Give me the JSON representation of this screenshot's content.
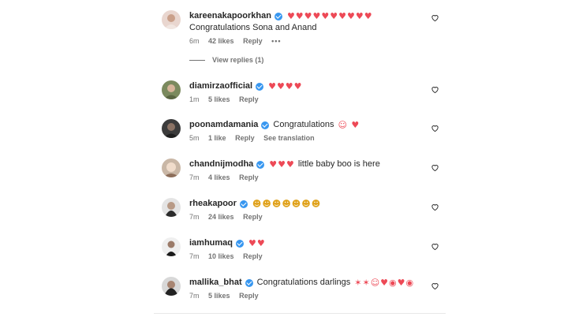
{
  "comments": [
    {
      "username": "kareenakapoorkhan",
      "text": "",
      "emoji": "♥♥♥♥♥♥♥♥♥♥",
      "emoji_kind": "heart",
      "second_line": "Congratulations Sona and Anand",
      "time": "6m",
      "likes": "42 likes",
      "reply": "Reply",
      "more": "•••",
      "extra": ""
    },
    {
      "username": "diamirzaofficial",
      "text": "",
      "emoji": "♥♥♥♥",
      "emoji_kind": "heart",
      "second_line": "",
      "time": "1m",
      "likes": "5 likes",
      "reply": "Reply",
      "more": "",
      "extra": ""
    },
    {
      "username": "poonamdamania",
      "text": "Congratulations",
      "emoji": "☺ ♥",
      "emoji_kind": "mixed",
      "second_line": "",
      "time": "5m",
      "likes": "1 like",
      "reply": "Reply",
      "more": "",
      "extra": "See translation"
    },
    {
      "username": "chandnijmodha",
      "text": "little baby boo is here",
      "emoji": "♥♥♥",
      "emoji_kind": "heart-before",
      "second_line": "",
      "time": "7m",
      "likes": "4 likes",
      "reply": "Reply",
      "more": "",
      "extra": ""
    },
    {
      "username": "rheakapoor",
      "text": "",
      "emoji": "☻☻☻☻☻☻☻",
      "emoji_kind": "face",
      "second_line": "",
      "time": "7m",
      "likes": "24 likes",
      "reply": "Reply",
      "more": "",
      "extra": ""
    },
    {
      "username": "iamhumaq",
      "text": "",
      "emoji": "♥♥",
      "emoji_kind": "heart",
      "second_line": "",
      "time": "7m",
      "likes": "10 likes",
      "reply": "Reply",
      "more": "",
      "extra": ""
    },
    {
      "username": "mallika_bhat",
      "text": "Congratulations darlings",
      "emoji": "✶✶☺♥◉♥◉",
      "emoji_kind": "mixed",
      "second_line": "",
      "time": "7m",
      "likes": "5 likes",
      "reply": "Reply",
      "more": "",
      "extra": ""
    }
  ],
  "view_replies": "View replies (1)",
  "colors": {
    "verified": "#3897f0",
    "heart_emoji": "#ed4956",
    "meta_text": "#737373"
  }
}
